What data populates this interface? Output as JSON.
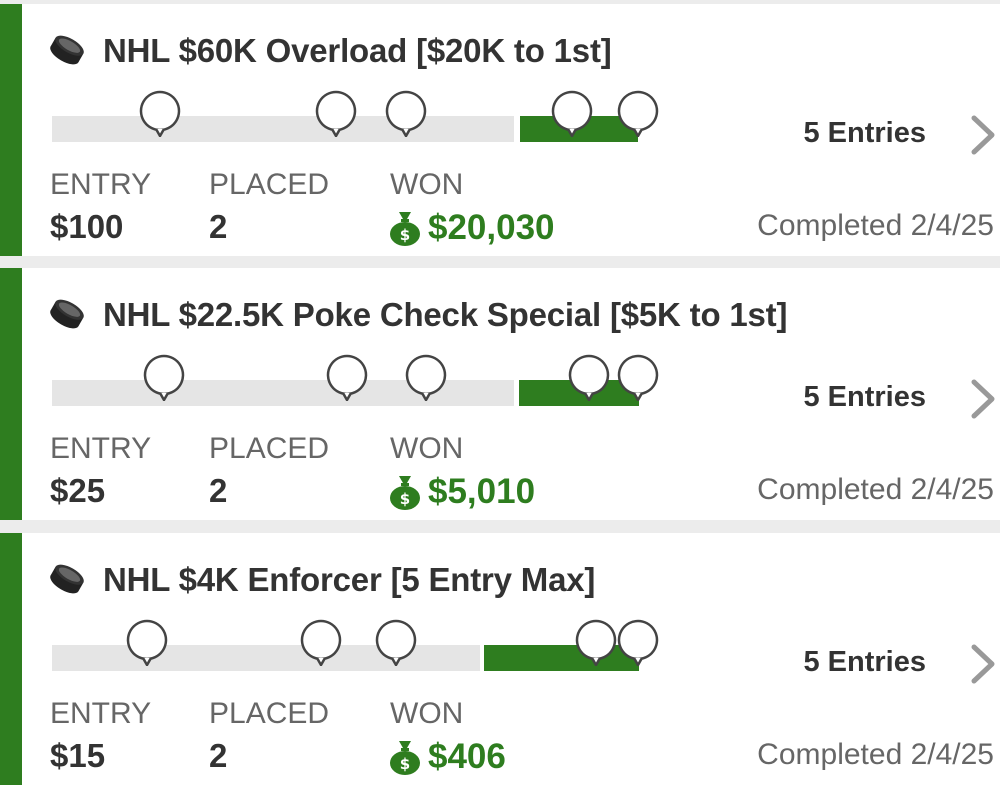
{
  "icons": {
    "puck": "hockey-puck-icon",
    "chevron": "chevron-right-icon",
    "money": "money-bag-icon",
    "pin": "entry-marker-icon"
  },
  "colors": {
    "accent": "#2e7d1f",
    "track": "#e5e5e5",
    "text": "#333333",
    "muted": "#666666"
  },
  "labels": {
    "entry": "ENTRY",
    "placed": "PLACED",
    "won": "WON"
  },
  "contests": [
    {
      "title": "NHL $60K Overload [$20K to 1st]",
      "entries": "5 Entries",
      "entry_fee": "$100",
      "placed": "2",
      "won": "$20,030",
      "status": "Completed 2/4/25"
    },
    {
      "title": "NHL $22.5K Poke Check Special [$5K to 1st]",
      "entries": "5 Entries",
      "entry_fee": "$25",
      "placed": "2",
      "won": "$5,010",
      "status": "Completed 2/4/25"
    },
    {
      "title": "NHL $4K Enforcer [5 Entry Max]",
      "entries": "5 Entries",
      "entry_fee": "$15",
      "placed": "2",
      "won": "$406",
      "status": "Completed 2/4/25"
    }
  ]
}
